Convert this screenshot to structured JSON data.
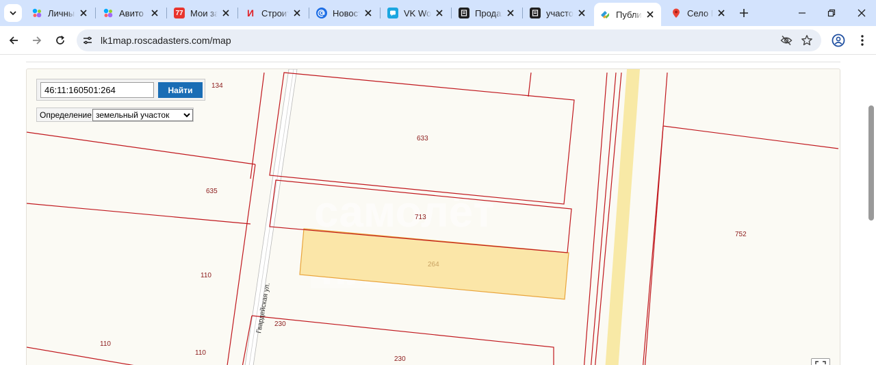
{
  "tabs": [
    {
      "title": "Личный кабинет",
      "favicon": "avito-dots-icon",
      "active": false
    },
    {
      "title": "Авито",
      "favicon": "avito-dots-icon",
      "active": false
    },
    {
      "title": "Мои заказы",
      "favicon": "calendar-77-icon",
      "active": false
    },
    {
      "title": "Строительство",
      "favicon": "letter-i-icon",
      "active": false
    },
    {
      "title": "Новости",
      "favicon": "at-sign-icon",
      "active": false
    },
    {
      "title": "VK Workspace",
      "favicon": "vk-workspace-icon",
      "active": false
    },
    {
      "title": "Продажа",
      "favicon": "doc-black-icon",
      "active": false
    },
    {
      "title": "участок",
      "favicon": "doc-black-icon",
      "active": false
    },
    {
      "title": "Публичная кадастровая карта",
      "favicon": "pkk-map-icon",
      "active": true
    },
    {
      "title": "Село П",
      "favicon": "map-pin-icon",
      "active": false
    }
  ],
  "favicon_text": {
    "calendar": "77",
    "letter_i": "И"
  },
  "address_bar": {
    "url": "lk1map.roscadasters.com/map"
  },
  "map": {
    "search_value": "46:11:160501:264",
    "search_button": "Найти",
    "definition_label": "Определение:",
    "definition_selected": "земельный участок",
    "street_name": "Гвардейская ул.",
    "selected_parcel": "264",
    "parcel_numbers": {
      "p134": "134",
      "p633": "633",
      "p635": "635",
      "p713": "713",
      "p752": "752",
      "p264": "264",
      "p110a": "110",
      "p110b": "110",
      "p110c": "110",
      "p230a": "230",
      "p230b": "230"
    },
    "colors": {
      "boundary": "#c0171d",
      "selected_fill": "#fbe6a8",
      "selected_stroke": "#e9a43a",
      "road": "#f8e9a6",
      "background": "#fbfaf4"
    }
  },
  "colors": {
    "tabstrip": "#d3e3fd",
    "omnibox": "#e9eef6",
    "button": "#1a6db5"
  }
}
